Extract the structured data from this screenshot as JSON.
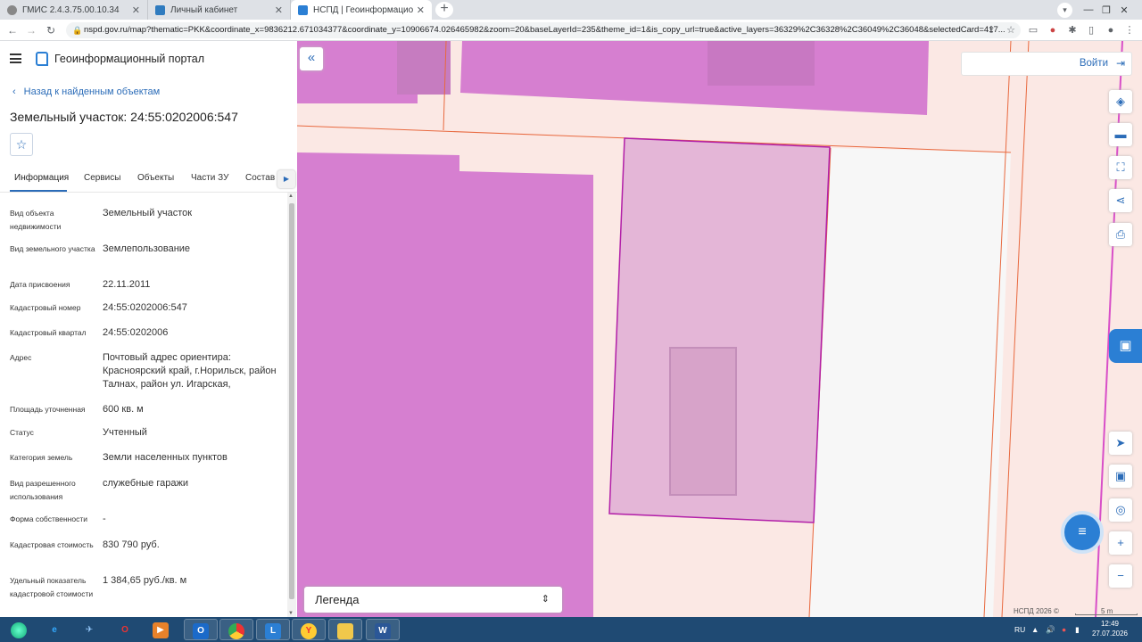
{
  "browser": {
    "tabs": [
      {
        "title": "ГМИС 2.4.3.75.00.10.34",
        "active": false
      },
      {
        "title": "Личный кабинет",
        "active": false
      },
      {
        "title": "НСПД | Геоинформационный п",
        "active": true
      }
    ],
    "url": "nspd.gov.ru/map?thematic=PKK&coordinate_x=9836212.671034377&coordinate_y=10906674.026465982&zoom=20&baseLayerId=235&theme_id=1&is_copy_url=true&active_layers=36329%2C36328%2C36049%2C36048&selectedCard=417..."
  },
  "portal": {
    "title": "Геоинформационный портал",
    "back_label": "Назад к найденным объектам",
    "object_title": "Земельный участок: 24:55:0202006:547"
  },
  "panel_tabs": [
    "Информация",
    "Сервисы",
    "Объекты",
    "Части ЗУ",
    "Состав"
  ],
  "info_rows": [
    {
      "label": "Вид объекта недвижимости",
      "value": "Земельный участок"
    },
    {
      "label": "Вид земельного участка",
      "value": "Землепользование"
    },
    {
      "label": "Дата присвоения",
      "value": "22.11.2011"
    },
    {
      "label": "Кадастровый номер",
      "value": "24:55:0202006:547"
    },
    {
      "label": "Кадастровый квартал",
      "value": "24:55:0202006"
    },
    {
      "label": "Адрес",
      "value": "Почтовый адрес ориентира: Красноярский край, г.Норильск, район Талнах, район ул. Игарская,"
    },
    {
      "label": "Площадь уточненная",
      "value": "600 кв. м"
    },
    {
      "label": "Статус",
      "value": "Учтенный"
    },
    {
      "label": "Категория земель",
      "value": "Земли населенных пунктов"
    },
    {
      "label": "Вид разрешенного использования",
      "value": "служебные гаражи"
    },
    {
      "label": "Форма собственности",
      "value": "-"
    },
    {
      "label": "Кадастровая стоимость",
      "value": "830 790 руб."
    },
    {
      "label": "Удельный показатель кадастровой стоимости",
      "value": "1 384,65 руб./кв. м"
    }
  ],
  "map": {
    "login_label": "Войти",
    "legend_label": "Легенда",
    "attribution": "НСПД 2026 ©",
    "scale_label": "5 m",
    "colors": {
      "parcel_fill": "#d67fd0",
      "parcel_border": "#b21fa8",
      "selected_fill": "#e4b6d7",
      "boundary": "#e8693f"
    }
  },
  "taskbar": {
    "lang": "RU",
    "time": "12:49",
    "date": "27.07.2026"
  }
}
